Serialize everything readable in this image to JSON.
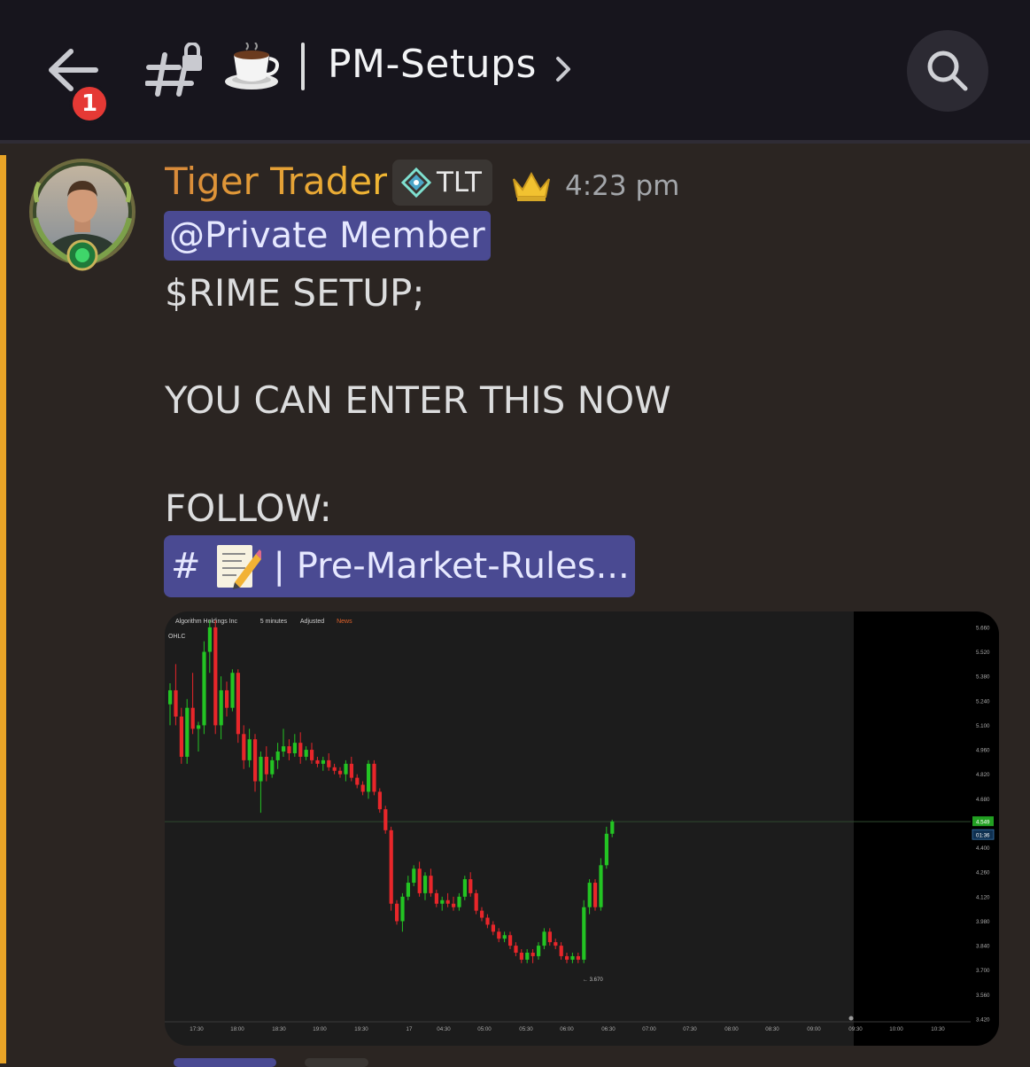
{
  "header": {
    "back_badge": "1",
    "channel_emoji": "☕",
    "channel_name": "PM-Setups"
  },
  "message": {
    "author": "Tiger Trader",
    "tag": "TLT",
    "time": "4:23 pm",
    "mention": "@Private Member",
    "lines": [
      "$RIME SETUP;",
      "YOU CAN ENTER THIS NOW",
      "FOLLOW:"
    ],
    "channel_link": "| Pre-Market-Rules...",
    "channel_link_hash": "#"
  },
  "chart_data": {
    "type": "candlestick",
    "header_text": [
      "Algorithm Holdings Inc",
      "5 minutes",
      "Adjusted",
      "News"
    ],
    "ohlc_label": "OHLC",
    "yticks": [
      5.66,
      5.52,
      5.38,
      5.24,
      5.1,
      4.96,
      4.82,
      4.68,
      4.549,
      4.4,
      4.26,
      4.12,
      3.98,
      3.84,
      3.7,
      3.56,
      3.42
    ],
    "ytick_labels": [
      "5.660",
      "5.520",
      "5.380",
      "5.240",
      "5.100",
      "4.960",
      "4.820",
      "4.680",
      "4.549",
      "01:36",
      "4.400",
      "4.260",
      "4.120",
      "3.980",
      "3.840",
      "3.700",
      "3.560",
      "3.420"
    ],
    "xtick_labels": [
      "17:30",
      "18:00",
      "18:30",
      "19:00",
      "19:30",
      "17",
      "04:30",
      "05:00",
      "05:30",
      "06:00",
      "06:30",
      "07:00",
      "07:30",
      "08:00",
      "08:30",
      "09:00",
      "09:30",
      "10:00",
      "10:30"
    ],
    "last_price": "4.549",
    "countdown": "01:36",
    "low_marker": "3.670",
    "ylim": [
      3.42,
      5.7
    ],
    "candles": [
      [
        5.22,
        5.34,
        5.1,
        5.3
      ],
      [
        5.3,
        5.45,
        5.1,
        5.15
      ],
      [
        5.15,
        5.2,
        4.88,
        4.92
      ],
      [
        4.92,
        5.25,
        4.88,
        5.2
      ],
      [
        5.2,
        5.4,
        5.05,
        5.08
      ],
      [
        5.08,
        5.12,
        4.95,
        5.1
      ],
      [
        5.1,
        5.58,
        5.05,
        5.52
      ],
      [
        5.52,
        5.7,
        5.4,
        5.66
      ],
      [
        5.66,
        5.7,
        5.05,
        5.1
      ],
      [
        5.1,
        5.38,
        5.02,
        5.3
      ],
      [
        5.3,
        5.35,
        5.15,
        5.2
      ],
      [
        5.2,
        5.42,
        5.18,
        5.4
      ],
      [
        5.4,
        5.42,
        5.0,
        5.05
      ],
      [
        5.05,
        5.1,
        4.85,
        4.9
      ],
      [
        4.9,
        5.08,
        4.86,
        5.02
      ],
      [
        5.02,
        5.05,
        4.72,
        4.78
      ],
      [
        4.78,
        4.95,
        4.6,
        4.92
      ],
      [
        4.92,
        4.98,
        4.78,
        4.82
      ],
      [
        4.82,
        4.92,
        4.8,
        4.9
      ],
      [
        4.9,
        5.0,
        4.85,
        4.95
      ],
      [
        4.95,
        5.08,
        4.92,
        4.98
      ],
      [
        4.98,
        5.02,
        4.9,
        4.94
      ],
      [
        4.94,
        5.05,
        4.92,
        5.0
      ],
      [
        5.0,
        5.06,
        4.88,
        4.92
      ],
      [
        4.92,
        4.98,
        4.9,
        4.96
      ],
      [
        4.96,
        5.0,
        4.88,
        4.9
      ],
      [
        4.9,
        4.92,
        4.86,
        4.88
      ],
      [
        4.88,
        4.92,
        4.84,
        4.9
      ],
      [
        4.9,
        4.94,
        4.84,
        4.86
      ],
      [
        4.86,
        4.88,
        4.82,
        4.84
      ],
      [
        4.84,
        4.86,
        4.8,
        4.82
      ],
      [
        4.82,
        4.9,
        4.78,
        4.88
      ],
      [
        4.88,
        4.92,
        4.78,
        4.8
      ],
      [
        4.8,
        4.82,
        4.74,
        4.76
      ],
      [
        4.76,
        4.78,
        4.7,
        4.72
      ],
      [
        4.72,
        4.9,
        4.68,
        4.88
      ],
      [
        4.88,
        4.9,
        4.7,
        4.72
      ],
      [
        4.72,
        4.74,
        4.6,
        4.62
      ],
      [
        4.62,
        4.64,
        4.48,
        4.5
      ],
      [
        4.5,
        4.52,
        4.04,
        4.08
      ],
      [
        4.08,
        4.1,
        3.96,
        3.98
      ],
      [
        3.98,
        4.14,
        3.92,
        4.12
      ],
      [
        4.12,
        4.24,
        4.1,
        4.2
      ],
      [
        4.2,
        4.3,
        4.18,
        4.28
      ],
      [
        4.28,
        4.32,
        4.12,
        4.14
      ],
      [
        4.14,
        4.26,
        4.1,
        4.24
      ],
      [
        4.24,
        4.28,
        4.12,
        4.14
      ],
      [
        4.14,
        4.16,
        4.06,
        4.08
      ],
      [
        4.08,
        4.12,
        4.04,
        4.1
      ],
      [
        4.1,
        4.14,
        4.06,
        4.08
      ],
      [
        4.08,
        4.12,
        4.04,
        4.06
      ],
      [
        4.06,
        4.14,
        4.04,
        4.12
      ],
      [
        4.12,
        4.24,
        4.1,
        4.22
      ],
      [
        4.22,
        4.26,
        4.12,
        4.14
      ],
      [
        4.14,
        4.16,
        4.02,
        4.04
      ],
      [
        4.04,
        4.06,
        3.98,
        4.0
      ],
      [
        4.0,
        4.02,
        3.94,
        3.96
      ],
      [
        3.96,
        3.98,
        3.9,
        3.92
      ],
      [
        3.92,
        3.94,
        3.86,
        3.88
      ],
      [
        3.88,
        3.92,
        3.86,
        3.9
      ],
      [
        3.9,
        3.92,
        3.82,
        3.84
      ],
      [
        3.84,
        3.86,
        3.78,
        3.8
      ],
      [
        3.8,
        3.82,
        3.74,
        3.76
      ],
      [
        3.76,
        3.82,
        3.74,
        3.8
      ],
      [
        3.8,
        3.82,
        3.74,
        3.78
      ],
      [
        3.78,
        3.86,
        3.76,
        3.84
      ],
      [
        3.84,
        3.94,
        3.82,
        3.92
      ],
      [
        3.92,
        3.94,
        3.84,
        3.86
      ],
      [
        3.86,
        3.88,
        3.82,
        3.84
      ],
      [
        3.84,
        3.86,
        3.76,
        3.78
      ],
      [
        3.78,
        3.8,
        3.74,
        3.76
      ],
      [
        3.76,
        3.8,
        3.74,
        3.78
      ],
      [
        3.78,
        3.8,
        3.74,
        3.76
      ],
      [
        3.76,
        4.1,
        3.74,
        4.06
      ],
      [
        4.06,
        4.22,
        4.02,
        4.2
      ],
      [
        4.2,
        4.22,
        4.04,
        4.06
      ],
      [
        4.06,
        4.34,
        4.04,
        4.3
      ],
      [
        4.3,
        4.52,
        4.28,
        4.48
      ],
      [
        4.48,
        4.56,
        4.46,
        4.55
      ]
    ]
  }
}
